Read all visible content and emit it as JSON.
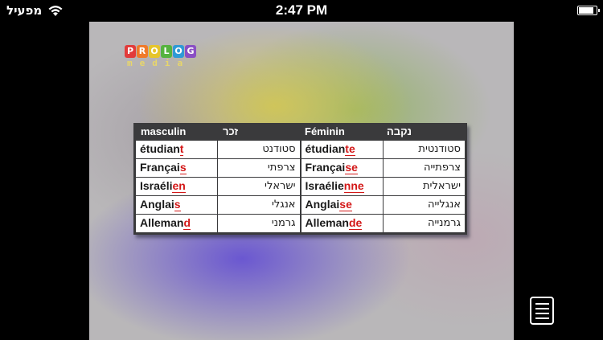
{
  "statusbar": {
    "carrier": "מפעיל",
    "time": "2:47 PM",
    "battery_level": 0.92,
    "wifi_icon": "wifi-icon",
    "battery_icon": "battery-icon"
  },
  "video": {
    "logo": {
      "letters": [
        {
          "char": "P",
          "color": "#e23b3b"
        },
        {
          "char": "R",
          "color": "#f07a2a"
        },
        {
          "char": "O",
          "color": "#e6c52b"
        },
        {
          "char": "L",
          "color": "#55b33f"
        },
        {
          "char": "O",
          "color": "#2f9ad6"
        },
        {
          "char": "G",
          "color": "#8a4fc4"
        }
      ],
      "subtitle": "media"
    },
    "table": {
      "headers": [
        "masculin",
        "זכר",
        "Féminin",
        "נקבה"
      ],
      "rows": [
        {
          "masc_stem": "étudian",
          "masc_suffix": "t",
          "masc_he": "סטודנט",
          "fem_stem": "étudian",
          "fem_suffix": "te",
          "fem_he": "סטודנטית"
        },
        {
          "masc_stem": "Françai",
          "masc_suffix": "s",
          "masc_he": "צרפתי",
          "fem_stem": "Françai",
          "fem_suffix": "se",
          "fem_he": "צרפתייה"
        },
        {
          "masc_stem": "Israéli",
          "masc_suffix": "en",
          "masc_he": "ישראלי",
          "fem_stem": "Israélie",
          "fem_suffix": "nne",
          "fem_he": "ישראלית"
        },
        {
          "masc_stem": "Anglai",
          "masc_suffix": "s",
          "masc_he": "אנגלי",
          "fem_stem": "Anglai",
          "fem_suffix": "se",
          "fem_he": "אנגלייה"
        },
        {
          "masc_stem": "Alleman",
          "masc_suffix": "d",
          "masc_he": "גרמני",
          "fem_stem": "Alleman",
          "fem_suffix": "de",
          "fem_he": "גרמנייה"
        }
      ],
      "suffix_color": "#d31818"
    }
  },
  "controls": {
    "list_icon": "list-icon"
  }
}
